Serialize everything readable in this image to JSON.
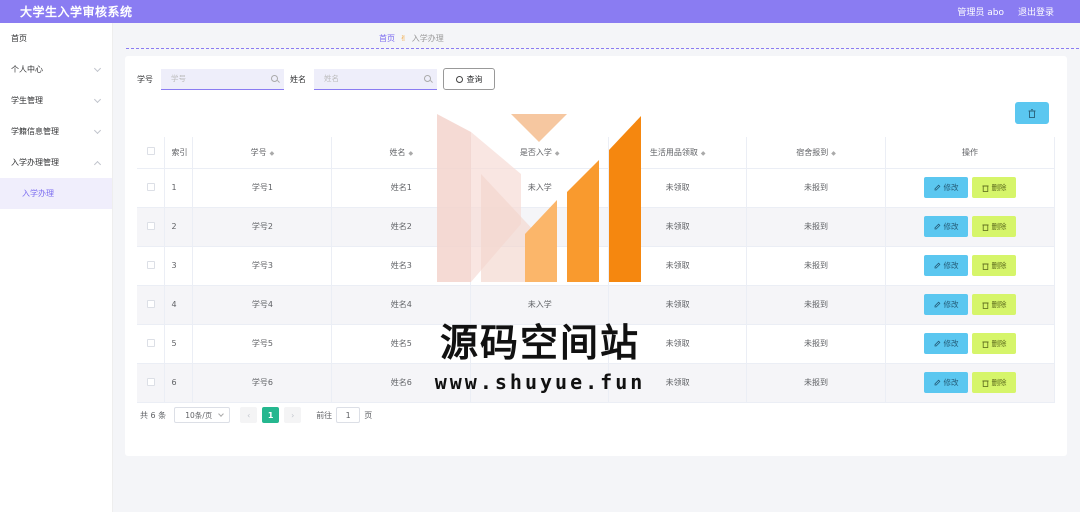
{
  "header": {
    "title": "大学生入学审核系统",
    "admin": "管理员 abo",
    "logout": "退出登录"
  },
  "sidebar": {
    "items": [
      {
        "label": "首页"
      },
      {
        "label": "个人中心"
      },
      {
        "label": "学生管理"
      },
      {
        "label": "学籍信息管理"
      },
      {
        "label": "入学办理管理"
      },
      {
        "label": "入学办理"
      }
    ]
  },
  "breadcrumb": {
    "home": "首页",
    "current": "入学办理"
  },
  "search": {
    "student_no_label": "学号",
    "student_no_placeholder": "学号",
    "name_label": "姓名",
    "name_placeholder": "姓名",
    "query_button": "查询"
  },
  "table": {
    "headers": [
      "索引",
      "学号",
      "姓名",
      "是否入学",
      "生活用品领取",
      "宿舍报到",
      "操作"
    ],
    "edit_label": "修改",
    "delete_label": "删除",
    "rows": [
      {
        "index": "1",
        "student_no": "学号1",
        "name": "姓名1",
        "enrolled": "未入学",
        "supplies": "未领取",
        "dorm": "未报到"
      },
      {
        "index": "2",
        "student_no": "学号2",
        "name": "姓名2",
        "enrolled": "",
        "supplies": "未领取",
        "dorm": "未报到"
      },
      {
        "index": "3",
        "student_no": "学号3",
        "name": "姓名3",
        "enrolled": "",
        "supplies": "未领取",
        "dorm": "未报到"
      },
      {
        "index": "4",
        "student_no": "学号4",
        "name": "姓名4",
        "enrolled": "未入学",
        "supplies": "未领取",
        "dorm": "未报到"
      },
      {
        "index": "5",
        "student_no": "学号5",
        "name": "姓名5",
        "enrolled": "",
        "supplies": "未领取",
        "dorm": "未报到"
      },
      {
        "index": "6",
        "student_no": "学号6",
        "name": "姓名6",
        "enrolled": "",
        "supplies": "未领取",
        "dorm": "未报到"
      }
    ]
  },
  "pagination": {
    "total": "共 6 条",
    "page_size": "10条/页",
    "current_page": "1",
    "goto_label": "前往",
    "goto_value": "1",
    "page_unit": "页"
  },
  "watermark": {
    "title": "源码空间站",
    "url": "www.shuyue.fun"
  },
  "colors": {
    "topbar": "#8a7cf2",
    "edit_btn": "#5bc7f0",
    "delete_btn": "#d6f56a",
    "active_page": "#25b78f"
  },
  "icons": {
    "sort": "sort-caret-icon",
    "edit": "edit-icon",
    "delete": "trash-icon",
    "search": "search-icon"
  }
}
